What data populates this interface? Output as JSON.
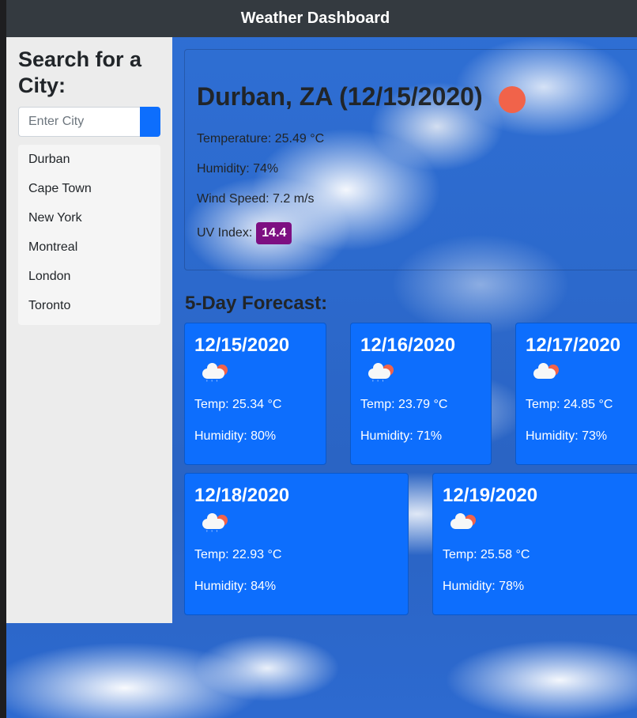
{
  "app": {
    "title": "Weather Dashboard"
  },
  "sidebar": {
    "heading": "Search for a City:",
    "search_placeholder": "Enter City",
    "cities": [
      "Durban",
      "Cape Town",
      "New York",
      "Montreal",
      "London",
      "Toronto"
    ]
  },
  "current": {
    "title": "Durban, ZA (12/15/2020)",
    "temperature": "Temperature: 25.49 °C",
    "humidity": "Humidity: 74%",
    "wind": "Wind Speed: 7.2 m/s",
    "uv_label": "UV Index:",
    "uv_value": "14.4",
    "icon": "sun-icon"
  },
  "forecast": {
    "heading": "5-Day Forecast:",
    "days": [
      {
        "date": "12/15/2020",
        "icon": "rain-cloud-icon",
        "temp": "Temp: 25.34 °C",
        "humidity": "Humidity: 80%"
      },
      {
        "date": "12/16/2020",
        "icon": "rain-cloud-icon",
        "temp": "Temp: 23.79 °C",
        "humidity": "Humidity: 71%"
      },
      {
        "date": "12/17/2020",
        "icon": "partly-cloudy-icon",
        "temp": "Temp: 24.85 °C",
        "humidity": "Humidity: 73%"
      },
      {
        "date": "12/18/2020",
        "icon": "rain-cloud-icon",
        "temp": "Temp: 22.93 °C",
        "humidity": "Humidity: 84%"
      },
      {
        "date": "12/19/2020",
        "icon": "partly-cloudy-icon",
        "temp": "Temp: 25.58 °C",
        "humidity": "Humidity: 78%"
      }
    ]
  },
  "colors": {
    "navbar": "#343a40",
    "primary": "#0d6efd",
    "uv_badge": "#7d0f82",
    "sun": "#f1634a"
  }
}
